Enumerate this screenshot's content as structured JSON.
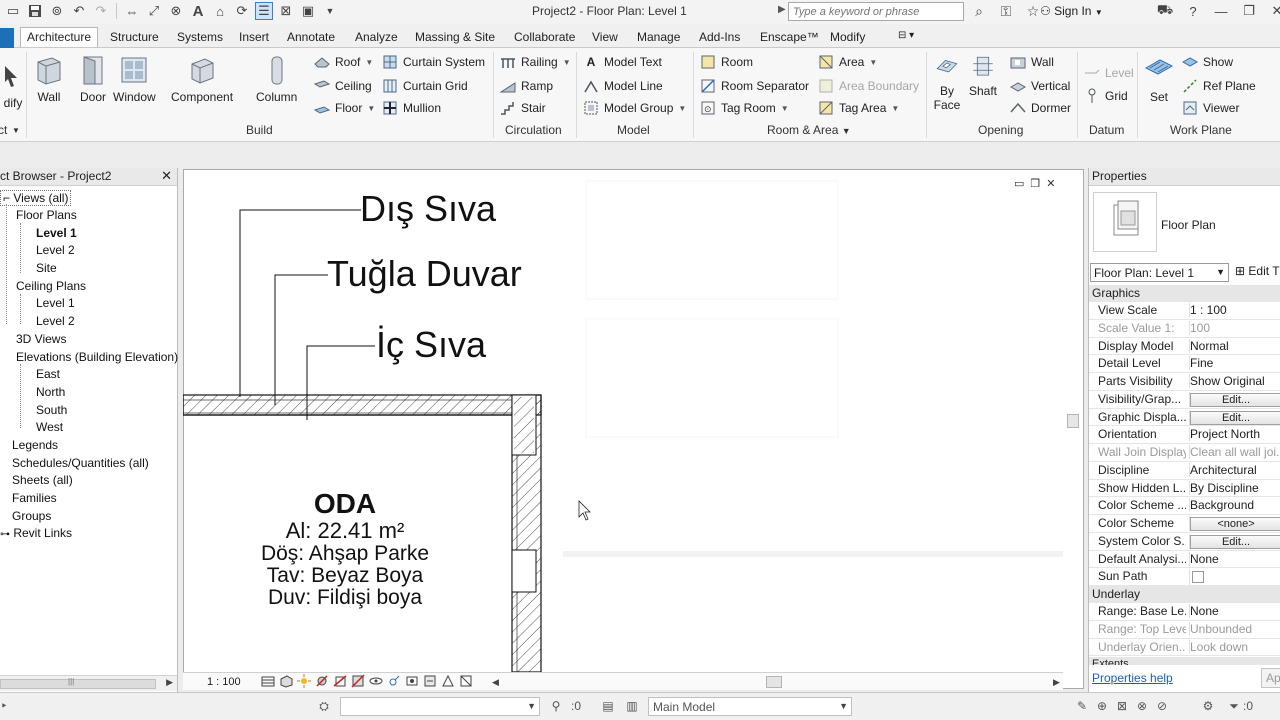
{
  "titlebar": {
    "title": "Project2 - Floor Plan: Level 1",
    "search_placeholder": "Type a keyword or phrase",
    "sign_in": "Sign In"
  },
  "tabs": [
    {
      "label": "Architecture",
      "active": true
    },
    {
      "label": "Structure"
    },
    {
      "label": "Systems"
    },
    {
      "label": "Insert"
    },
    {
      "label": "Annotate"
    },
    {
      "label": "Analyze"
    },
    {
      "label": "Massing & Site"
    },
    {
      "label": "Collaborate"
    },
    {
      "label": "View"
    },
    {
      "label": "Manage"
    },
    {
      "label": "Add-Ins"
    },
    {
      "label": "Enscape™"
    },
    {
      "label": "Modify"
    }
  ],
  "ribbon": {
    "modify": "dify",
    "modify_sub": "ct",
    "wall": "Wall",
    "door": "Door",
    "window": "Window",
    "component": "Component",
    "column": "Column",
    "roof": "Roof",
    "ceiling": "Ceiling",
    "floor": "Floor",
    "curtain_system": "Curtain System",
    "curtain_grid": "Curtain Grid",
    "mullion": "Mullion",
    "railing": "Railing",
    "ramp": "Ramp",
    "stair": "Stair",
    "model_text": "Model Text",
    "model_line": "Model Line",
    "model_group": "Model Group",
    "room": "Room",
    "room_separator": "Room Separator",
    "tag_room": "Tag Room",
    "area": "Area",
    "area_boundary": "Area Boundary",
    "tag_area": "Tag Area",
    "by_face_1": "By",
    "by_face_2": "Face",
    "shaft": "Shaft",
    "wall_opening": "Wall",
    "vertical": "Vertical",
    "dormer": "Dormer",
    "level": "Level",
    "grid": "Grid",
    "set": "Set",
    "show": "Show",
    "ref_plane": "Ref Plane",
    "viewer": "Viewer",
    "panels": {
      "build": "Build",
      "circulation": "Circulation",
      "model": "Model",
      "room_area": "Room & Area",
      "opening": "Opening",
      "datum": "Datum",
      "work_plane": "Work Plane"
    }
  },
  "project_browser": {
    "title": "ct Browser - Project2",
    "items": {
      "views": "Views (all)",
      "floor_plans": "Floor Plans",
      "fp_level1": "Level 1",
      "fp_level2": "Level 2",
      "fp_site": "Site",
      "ceiling_plans": "Ceiling Plans",
      "cp_level1": "Level 1",
      "cp_level2": "Level 2",
      "views_3d": "3D Views",
      "elevations": "Elevations (Building Elevation)",
      "east": "East",
      "north": "North",
      "south": "South",
      "west": "West",
      "legends": "Legends",
      "schedules": "Schedules/Quantities (all)",
      "sheets": "Sheets (all)",
      "families": "Families",
      "groups": "Groups",
      "revit_links": "Revit Links"
    }
  },
  "drawing": {
    "callout_1": "Dış Sıva",
    "callout_2": "Tuğla Duvar",
    "callout_3": "İç Sıva",
    "room_name": "ODA",
    "room_area": "Al: 22.41 m²",
    "room_floor": "Döş: Ahşap Parke",
    "room_ceiling": "Tav: Beyaz Boya",
    "room_wall": "Duv: Fildişi boya",
    "scale": "1 : 100"
  },
  "properties": {
    "title": "Properties",
    "type_name": "Floor Plan",
    "type_selector": "Floor Plan: Level 1",
    "edit_type": "Edit T",
    "group_graphics": "Graphics",
    "group_underlay": "Underlay",
    "group_extents": "Extents",
    "rows": [
      {
        "name": "View Scale",
        "value": "1 : 100"
      },
      {
        "name": "Scale Value    1:",
        "value": "100",
        "dim": true
      },
      {
        "name": "Display Model",
        "value": "Normal"
      },
      {
        "name": "Detail Level",
        "value": "Fine"
      },
      {
        "name": "Parts Visibility",
        "value": "Show Original"
      },
      {
        "name": "Visibility/Grap...",
        "value": "Edit...",
        "button": true
      },
      {
        "name": "Graphic Displa...",
        "value": "Edit...",
        "button": true
      },
      {
        "name": "Orientation",
        "value": "Project North"
      },
      {
        "name": "Wall Join Display",
        "value": "Clean all wall joi...",
        "dim": true
      },
      {
        "name": "Discipline",
        "value": "Architectural"
      },
      {
        "name": "Show Hidden L...",
        "value": "By Discipline"
      },
      {
        "name": "Color Scheme ...",
        "value": "Background"
      },
      {
        "name": "Color Scheme",
        "value": "<none>",
        "button": true
      },
      {
        "name": "System Color S...",
        "value": "Edit...",
        "button": true
      },
      {
        "name": "Default Analysi...",
        "value": "None"
      },
      {
        "name": "Sun Path",
        "value": ""
      }
    ],
    "underlay_rows": [
      {
        "name": "Range: Base Le...",
        "value": "None"
      },
      {
        "name": "Range: Top Level",
        "value": "Unbounded",
        "dim": true
      },
      {
        "name": "Underlay Orien...",
        "value": "Look down",
        "dim": true
      }
    ],
    "help": "Properties help",
    "apply": "App"
  },
  "statusbar": {
    "workset_count": ":0",
    "design_option": "Main Model",
    "filter_count": ":0"
  }
}
